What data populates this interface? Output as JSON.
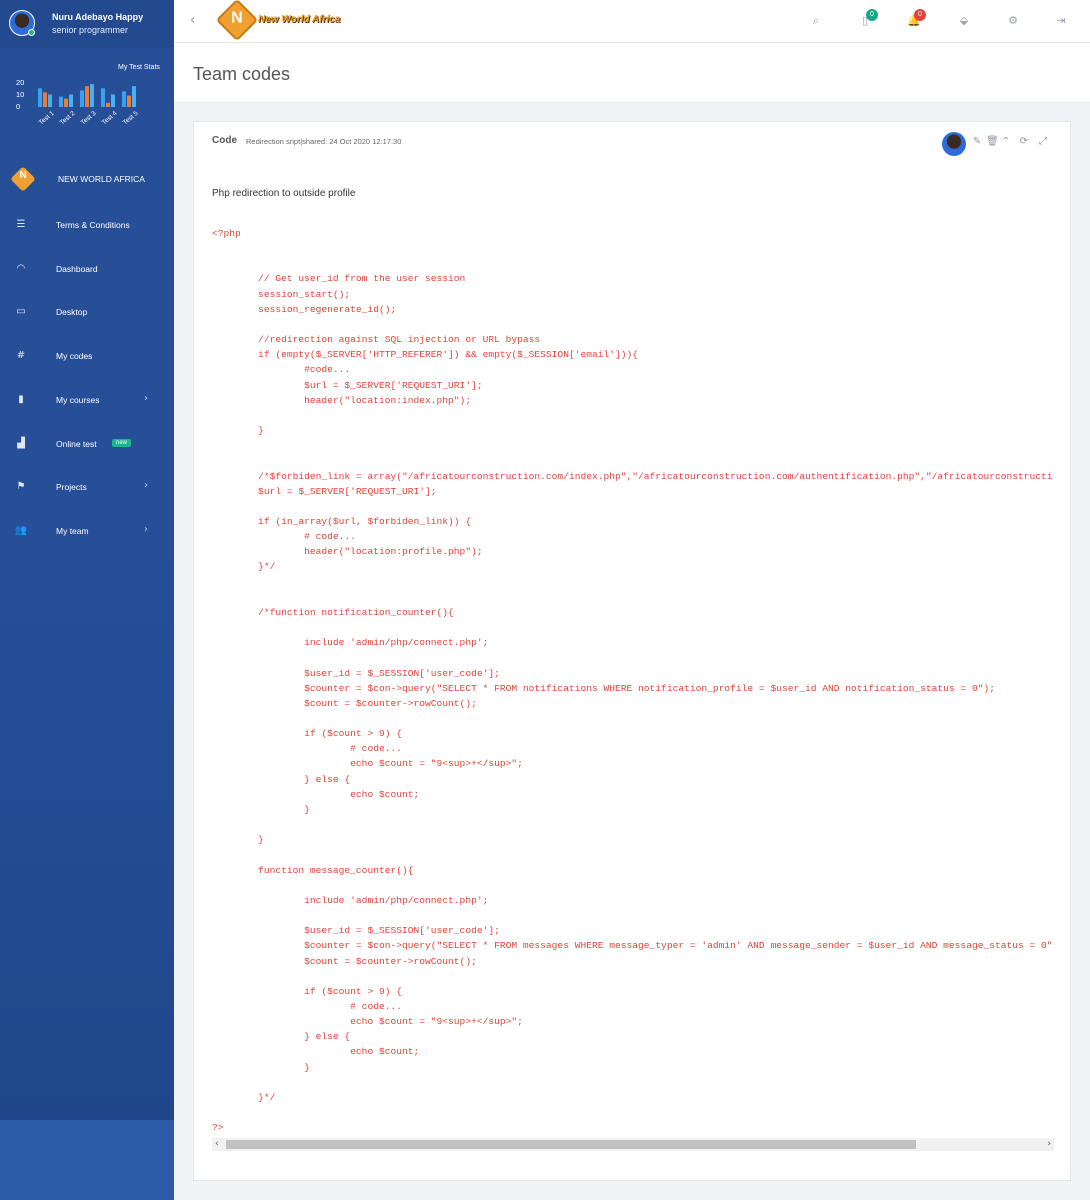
{
  "profile": {
    "name": "Nuru Adebayo Happy",
    "role": "senior programmer"
  },
  "stats": {
    "title": "My Test Stats",
    "chart_data": {
      "type": "bar",
      "title": "My Test Stats",
      "categories": [
        "Test 1",
        "Test 2",
        "Test 3",
        "Test 4",
        "Test 5"
      ],
      "series": [
        {
          "values": [
            18,
            10,
            16,
            18,
            15
          ],
          "color": "#3aa0f0"
        },
        {
          "values": [
            14,
            8,
            20,
            4,
            11
          ],
          "color": "#f07a30"
        },
        {
          "values": [
            12,
            12,
            22,
            12,
            20
          ],
          "color": "#4ab0f5"
        }
      ],
      "yticks": [
        "20",
        "10",
        "0"
      ],
      "ylim": [
        0,
        25
      ]
    }
  },
  "brand": {
    "initial": "N",
    "label": "NEW WORLD AFRICA"
  },
  "nav": [
    {
      "label": "Terms & Conditions",
      "icon": "list-icon",
      "glyph": "☰"
    },
    {
      "label": "Dashboard",
      "icon": "gauge-icon",
      "glyph": "◠"
    },
    {
      "label": "Desktop",
      "icon": "monitor-icon",
      "glyph": "▭"
    },
    {
      "label": "My codes",
      "icon": "hash-icon",
      "glyph": "#"
    },
    {
      "label": "My courses",
      "icon": "bookmark-icon",
      "glyph": "▮",
      "chevron": "›"
    },
    {
      "label": "Online test",
      "icon": "bar-chart-icon",
      "glyph": "▟",
      "badge": "new"
    },
    {
      "label": "Projects",
      "icon": "flag-icon",
      "glyph": "⚑",
      "chevron": "›"
    },
    {
      "label": "My team",
      "icon": "users-icon",
      "glyph": "👥",
      "chevron": "›"
    }
  ],
  "header": {
    "back_glyph": "‹",
    "logo_initial": "N",
    "logo_text": "New World Africa",
    "search_glyph": "⌕",
    "tasks_glyph": "▯",
    "tasks_count": "0",
    "bell_glyph": "🔔",
    "notifications_count": "0",
    "paint_glyph": "⬙",
    "settings_glyph": "⚙",
    "logout_glyph": "⇥",
    "colors": {
      "tasks_badge": "#17a884",
      "notify_badge": "#e0443a"
    }
  },
  "page": {
    "title": "Team codes"
  },
  "card": {
    "title": "Code",
    "subtitle": "Redirection sript|shared: 24 Oct 2020 12:17:30",
    "description": "Php redirection to outside profile",
    "tools": {
      "edit": "✎",
      "delete": "🗑",
      "collapse": "⌃",
      "refresh": "⟳",
      "expand": "⤢"
    },
    "code": "<?php\n\n\n        // Get user_id from the user session\n        session_start();\n        session_regenerate_id();\n\n        //redirection against SQL injection or URL bypass\n        if (empty($_SERVER['HTTP_REFERER']) && empty($_SESSION['email'])){\n                #code...\n                $url = $_SERVER['REQUEST_URI'];\n                header(\"location:index.php\");\n\n        }\n\n\n        /*$forbiden_link = array(\"/africatourconstruction.com/index.php\",\"/africatourconstruction.com/authentification.php\",\"/africatourconstructi\n        $url = $_SERVER['REQUEST_URI'];\n\n        if (in_array($url, $forbiden_link)) {\n                # code...\n                header(\"location:profile.php\");\n        }*/\n\n\n        /*function notification_counter(){\n\n                include 'admin/php/connect.php';\n\n                $user_id = $_SESSION['user_code'];\n                $counter = $con->query(\"SELECT * FROM notifications WHERE notification_profile = $user_id AND notification_status = 0\");\n                $count = $counter->rowCount();\n\n                if ($count > 9) {\n                        # code...\n                        echo $count = \"9<sup>+</sup>\";\n                } else {\n                        echo $count;\n                }\n\n        }\n\n        function message_counter(){\n\n                include 'admin/php/connect.php';\n\n                $user_id = $_SESSION['user_code'];\n                $counter = $con->query(\"SELECT * FROM messages WHERE message_typer = 'admin' AND message_sender = $user_id AND message_status = 0\"\n                $count = $counter->rowCount();\n\n                if ($count > 9) {\n                        # code...\n                        echo $count = \"9<sup>+</sup>\";\n                } else {\n                        echo $count;\n                }\n\n        }*/\n\n?>",
    "scroll_left": "‹",
    "scroll_right": "›"
  }
}
